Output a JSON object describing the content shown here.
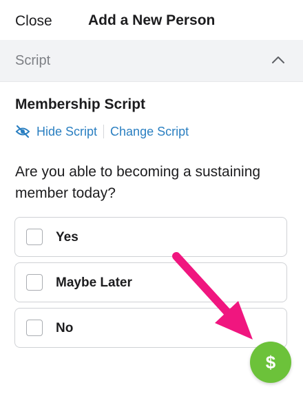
{
  "header": {
    "close_label": "Close",
    "title": "Add a New Person"
  },
  "section": {
    "label": "Script",
    "expanded": true
  },
  "script": {
    "heading": "Membership Script",
    "hide_label": "Hide Script",
    "change_label": "Change Script",
    "question": "Are you able to becoming a sustaining member today?"
  },
  "options": [
    {
      "label": "Yes",
      "checked": false
    },
    {
      "label": "Maybe Later",
      "checked": false
    },
    {
      "label": "No",
      "checked": false
    }
  ],
  "fab": {
    "symbol": "$",
    "icon": "dollar-icon"
  },
  "colors": {
    "link": "#2a7fc1",
    "fab": "#6cc23a",
    "annotation_arrow": "#f0167f",
    "section_bg": "#f2f3f5"
  },
  "annotation": {
    "icon": "pink-arrow-icon"
  }
}
